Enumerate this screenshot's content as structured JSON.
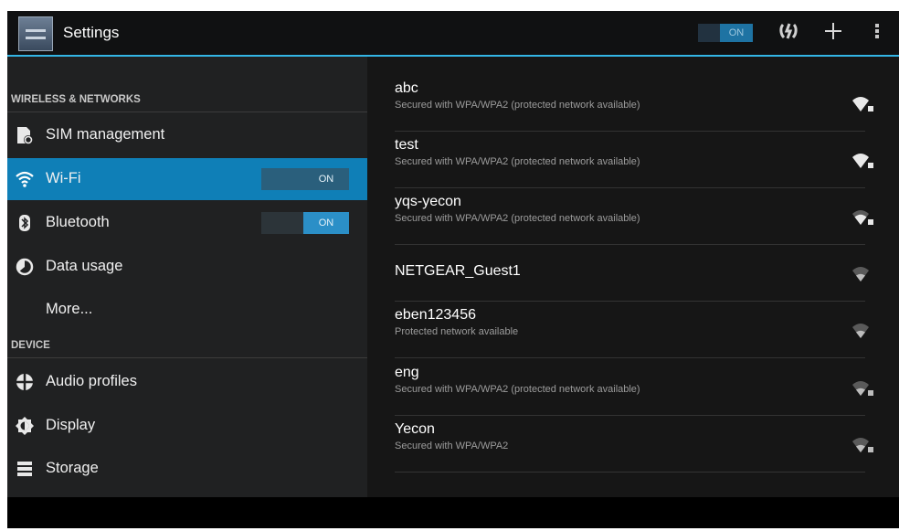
{
  "actionbar": {
    "title": "Settings",
    "switch_label": "ON",
    "icons": [
      "settings-app-icon",
      "wps-icon",
      "add-icon",
      "overflow-menu-icon"
    ]
  },
  "sidebar": {
    "sections": [
      {
        "header": "WIRELESS & NETWORKS",
        "items": [
          {
            "label": "SIM management",
            "icon": "sim-icon",
            "toggle": null,
            "active": false
          },
          {
            "label": "Wi-Fi",
            "icon": "wifi-icon",
            "toggle": "ON",
            "active": true
          },
          {
            "label": "Bluetooth",
            "icon": "bluetooth-icon",
            "toggle": "ON",
            "active": false
          },
          {
            "label": "Data usage",
            "icon": "data-usage-icon",
            "toggle": null,
            "active": false
          },
          {
            "label": "More...",
            "icon": null,
            "toggle": null,
            "active": false
          }
        ]
      },
      {
        "header": "DEVICE",
        "items": [
          {
            "label": "Audio profiles",
            "icon": "audio-profiles-icon",
            "toggle": null,
            "active": false
          },
          {
            "label": "Display",
            "icon": "display-icon",
            "toggle": null,
            "active": false
          },
          {
            "label": "Storage",
            "icon": "storage-icon",
            "toggle": null,
            "active": false
          }
        ]
      }
    ]
  },
  "networks": [
    {
      "ssid": "abc",
      "status": "Secured with WPA/WPA2 (protected network available)",
      "locked": true,
      "signal": 4
    },
    {
      "ssid": "test",
      "status": "Secured with WPA/WPA2 (protected network available)",
      "locked": true,
      "signal": 4
    },
    {
      "ssid": "yqs-yecon",
      "status": "Secured with WPA/WPA2 (protected network available)",
      "locked": true,
      "signal": 3
    },
    {
      "ssid": "NETGEAR_Guest1",
      "status": "",
      "locked": false,
      "signal": 2
    },
    {
      "ssid": "eben123456",
      "status": "Protected network available",
      "locked": false,
      "signal": 2
    },
    {
      "ssid": "eng",
      "status": "Secured with WPA/WPA2 (protected network available)",
      "locked": true,
      "signal": 2
    },
    {
      "ssid": "Yecon",
      "status": "Secured with WPA/WPA2",
      "locked": true,
      "signal": 2
    }
  ],
  "colors": {
    "accent": "#33b5e5",
    "selected_row": "#0f7fb7",
    "background": "#1c1c1c"
  }
}
